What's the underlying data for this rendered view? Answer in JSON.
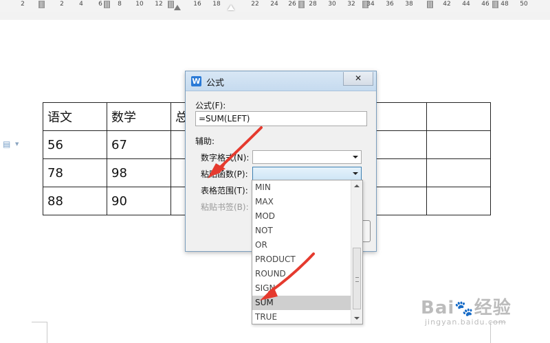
{
  "ruler": {
    "ticks": [
      "2",
      "2",
      "4",
      "6",
      "8",
      "10",
      "12",
      "16",
      "18",
      "22",
      "24",
      "26",
      "28",
      "30",
      "32",
      "34",
      "36",
      "38",
      "42",
      "44",
      "46",
      "48",
      "50"
    ]
  },
  "table": {
    "rows": [
      [
        "语文",
        "数学",
        "总",
        "",
        "",
        "",
        ""
      ],
      [
        "56",
        "67",
        "",
        "",
        "",
        "",
        ""
      ],
      [
        "78",
        "98",
        "",
        "",
        "",
        "",
        ""
      ],
      [
        "88",
        "90",
        "",
        "",
        "",
        "",
        ""
      ]
    ]
  },
  "dialog": {
    "title": "公式",
    "close_glyph": "✕",
    "formula_label": "公式(F):",
    "formula_value": "=SUM(LEFT)",
    "helper_label": "辅助:",
    "number_format_label": "数字格式(N):",
    "paste_function_label": "粘贴函数(P):",
    "table_range_label": "表格范围(T):",
    "paste_bookmark_label": "粘贴书签(B):"
  },
  "function_list": {
    "items": [
      "MIN",
      "MAX",
      "MOD",
      "NOT",
      "OR",
      "PRODUCT",
      "ROUND",
      "SIGN",
      "SUM",
      "TRUE"
    ],
    "selected": "SUM"
  },
  "colors": {
    "arrow_red": "#e53a2e",
    "dialog_border": "#7b9ebd",
    "selected_item": "#cfcfcf"
  },
  "watermark": {
    "brand_a": "Bai",
    "brand_paw": "🐾",
    "brand_b": "经验",
    "url": "jingyan.baidu.com"
  }
}
